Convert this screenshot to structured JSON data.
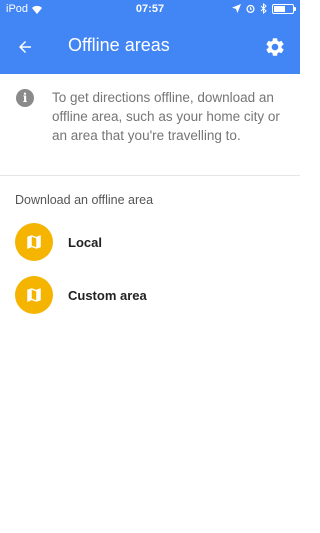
{
  "status_bar": {
    "carrier": "iPod",
    "time": "07:57",
    "battery_level": 0.6
  },
  "toolbar": {
    "title": "Offline areas",
    "back_icon": "arrow-left-icon",
    "settings_icon": "gear-icon"
  },
  "info": {
    "icon": "info-icon",
    "text": "To get directions offline, download an offline area, such as your home city or an area that you're travelling to."
  },
  "section": {
    "title": "Download an offline area",
    "items": [
      {
        "label": "Local",
        "icon": "map-icon"
      },
      {
        "label": "Custom area",
        "icon": "map-icon"
      }
    ]
  },
  "colors": {
    "header": "#4285f4",
    "item_icon_bg": "#f4b400"
  }
}
